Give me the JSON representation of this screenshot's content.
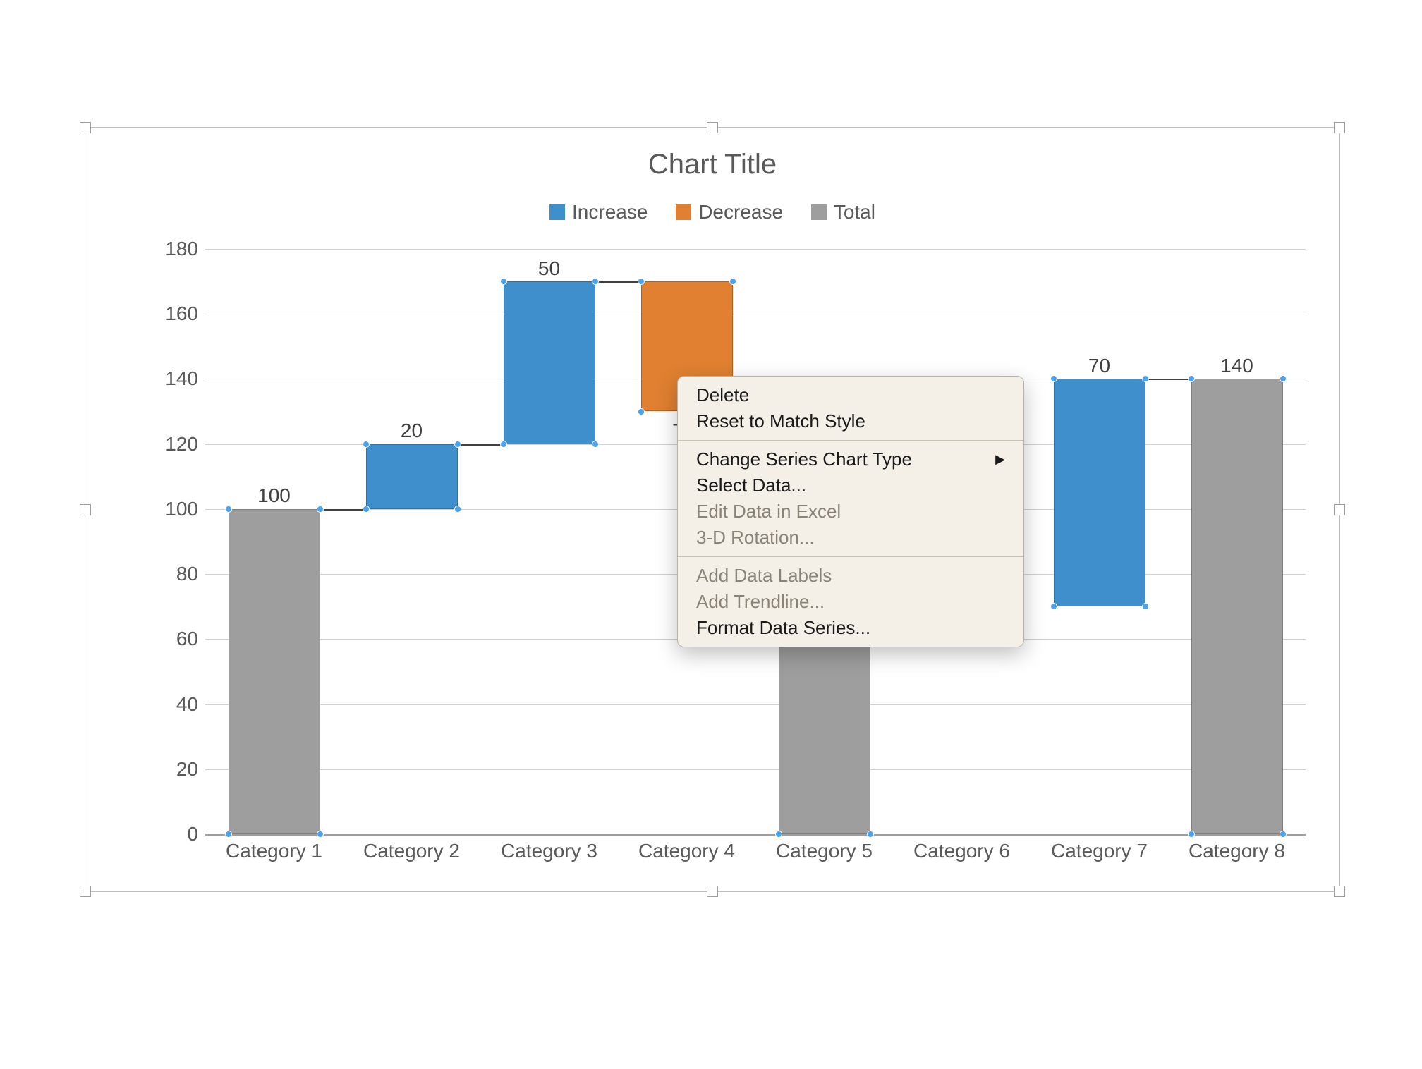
{
  "chart_data": {
    "type": "waterfall",
    "title": "Chart Title",
    "xlabel": "",
    "ylabel": "",
    "ylim": [
      0,
      180
    ],
    "yticks": [
      0,
      20,
      40,
      60,
      80,
      100,
      120,
      140,
      160,
      180
    ],
    "categories": [
      "Category 1",
      "Category 2",
      "Category 3",
      "Category 4",
      "Category 5",
      "Category 6",
      "Category 7",
      "Category 8"
    ],
    "legend": [
      {
        "name": "Increase",
        "color": "#3f8fcd"
      },
      {
        "name": "Decrease",
        "color": "#e08030"
      },
      {
        "name": "Total",
        "color": "#9e9e9e"
      }
    ],
    "bars": [
      {
        "category": "Category 1",
        "kind": "total",
        "start": 0,
        "end": 100,
        "label": "100"
      },
      {
        "category": "Category 2",
        "kind": "increase",
        "start": 100,
        "end": 120,
        "label": "20"
      },
      {
        "category": "Category 3",
        "kind": "increase",
        "start": 120,
        "end": 170,
        "label": "50"
      },
      {
        "category": "Category 4",
        "kind": "decrease",
        "start": 170,
        "end": 130,
        "label": "-40"
      },
      {
        "category": "Category 5",
        "kind": "total",
        "start": 0,
        "end": 130,
        "label": ""
      },
      {
        "category": "Category 6",
        "kind": "none",
        "start": 0,
        "end": 0,
        "label": ""
      },
      {
        "category": "Category 7",
        "kind": "increase",
        "start": 70,
        "end": 140,
        "label": "70"
      },
      {
        "category": "Category 8",
        "kind": "total",
        "start": 0,
        "end": 140,
        "label": "140"
      }
    ]
  },
  "yticks": {
    "0": "0",
    "1": "20",
    "2": "40",
    "3": "60",
    "4": "80",
    "5": "100",
    "6": "120",
    "7": "140",
    "8": "160",
    "9": "180"
  },
  "xlabels": {
    "0": "Category 1",
    "1": "Category 2",
    "2": "Category 3",
    "3": "Category 4",
    "4": "Category 5",
    "5": "Category 6",
    "6": "Category 7",
    "7": "Category 8"
  },
  "data_labels": {
    "0": "100",
    "1": "20",
    "2": "50",
    "3": "-40",
    "6": "70",
    "7": "140"
  },
  "legend_labels": {
    "increase": "Increase",
    "decrease": "Decrease",
    "total": "Total"
  },
  "title": "Chart Title",
  "context_menu": {
    "delete": "Delete",
    "reset": "Reset to Match Style",
    "change_type": "Change Series Chart Type",
    "select_data": "Select Data...",
    "edit_data": "Edit Data in Excel",
    "rotation": "3-D Rotation...",
    "add_labels": "Add Data Labels",
    "add_trend": "Add Trendline...",
    "format_series": "Format Data Series..."
  }
}
